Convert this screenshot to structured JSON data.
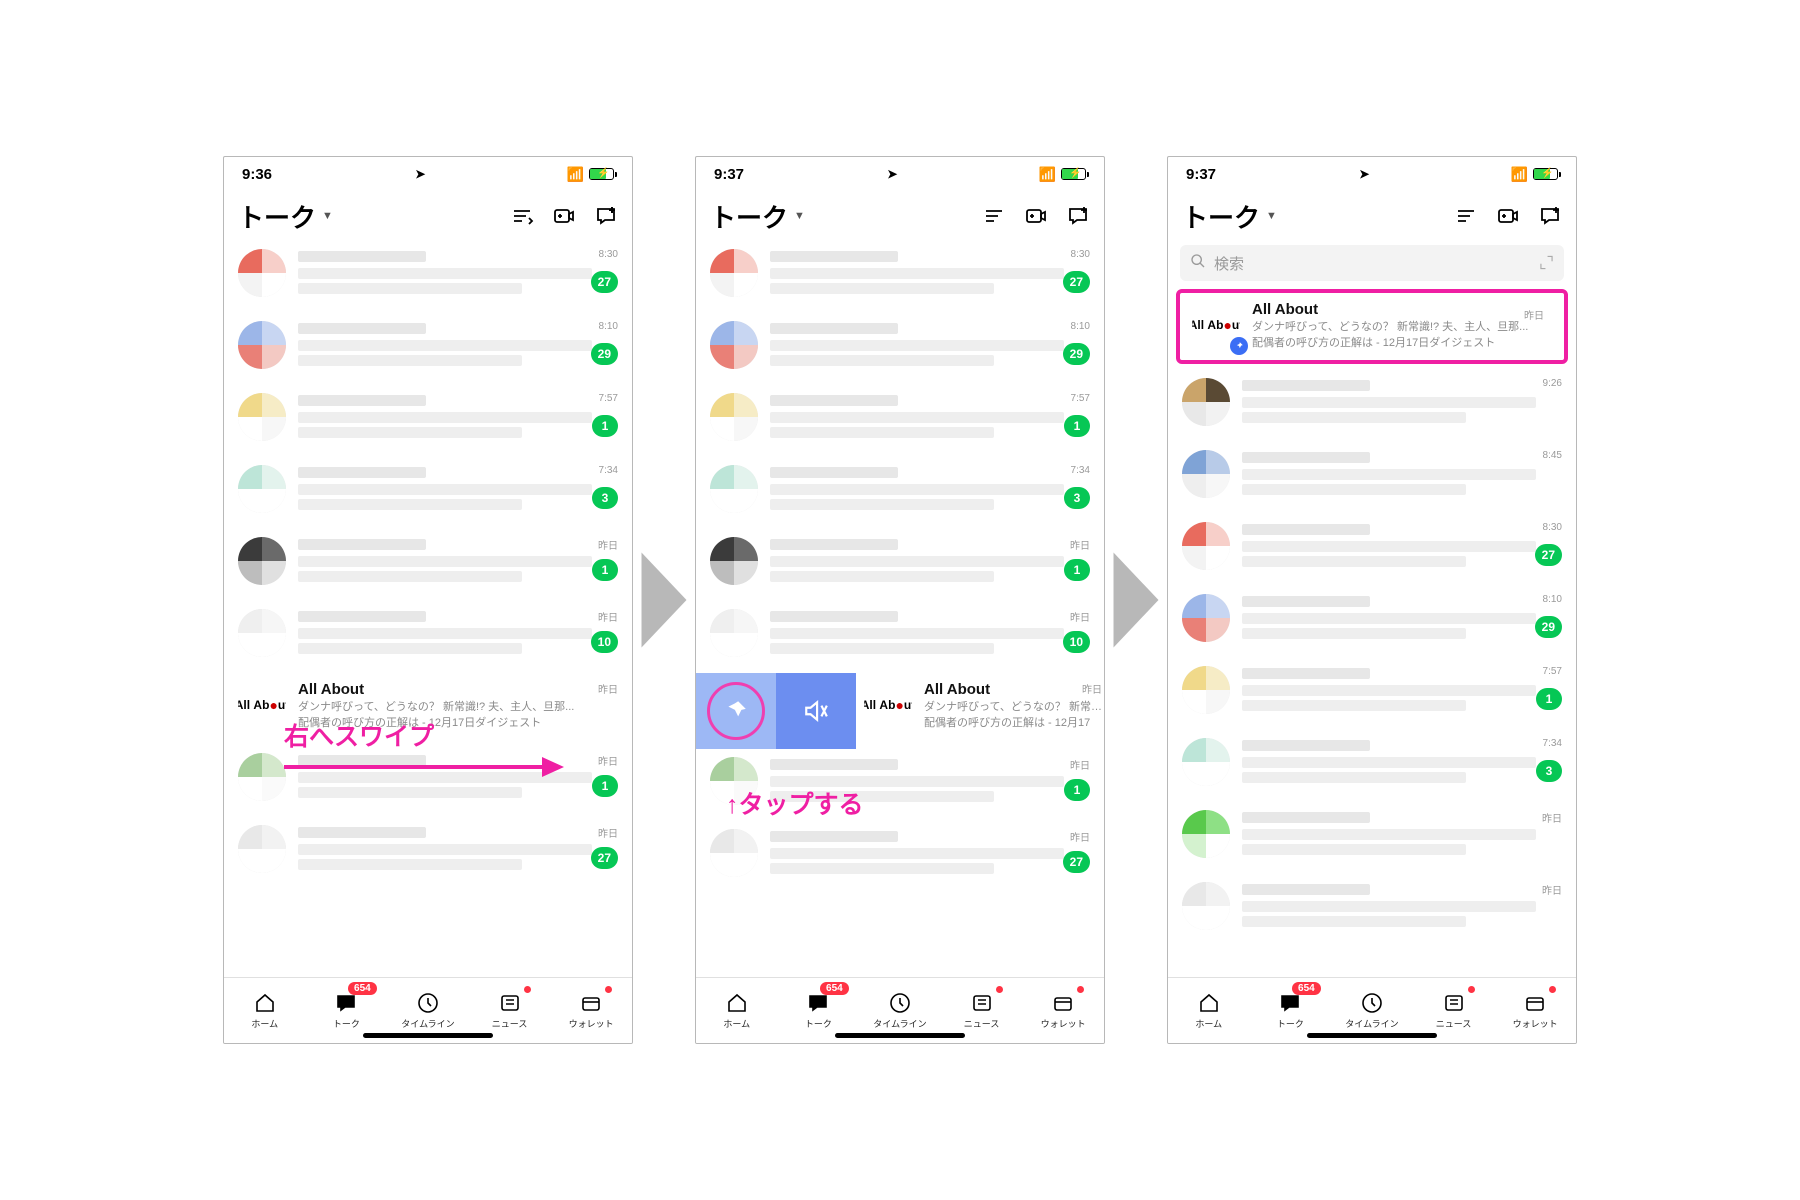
{
  "status": {
    "t1": "9:36",
    "t2": "9:37",
    "t3": "9:37"
  },
  "header": {
    "title": "トーク"
  },
  "search": {
    "placeholder": "検索"
  },
  "ann": {
    "swipe": "右へスワイプ",
    "tap": "↑タップする"
  },
  "allabout": {
    "name": "All About",
    "line1": "ダンナ呼びって、どうなの？ 新常識!? 夫、主人、旦那...",
    "line2": "配偶者の呼び方の正解は - 12月17日ダイジェスト",
    "line1s": "ダンナ呼びって、どうなの？ 新常…",
    "line2s": "配偶者の呼び方の正解は - 12月17",
    "when": "昨日"
  },
  "chats1": [
    {
      "time": "8:30",
      "badge": "27",
      "av": [
        "#e86b5e",
        "#f7cfc9",
        "#f3f3f3",
        "#fff"
      ]
    },
    {
      "time": "8:10",
      "badge": "29",
      "av": [
        "#9cb6e8",
        "#c8d6f2",
        "#e98077",
        "#f3c9c3"
      ]
    },
    {
      "time": "7:57",
      "badge": "1",
      "av": [
        "#f0d98a",
        "#f6ecc6",
        "#fff",
        "#f7f7f7"
      ]
    },
    {
      "time": "7:34",
      "badge": "3",
      "av": [
        "#bde5d8",
        "#e3f3ed",
        "#fff",
        "#fff"
      ]
    },
    {
      "time": "昨日",
      "badge": "1",
      "av": [
        "#3b3b3b",
        "#6a6a6a",
        "#bdbdbd",
        "#e0e0e0"
      ]
    },
    {
      "time": "昨日",
      "badge": "10",
      "av": [
        "#efefef",
        "#f6f6f6",
        "#fff",
        "#fff"
      ]
    },
    {
      "time": "昨日",
      "badge": "",
      "av": [
        "allabout"
      ]
    },
    {
      "time": "昨日",
      "badge": "1",
      "av": [
        "#a9cf9e",
        "#d4e8cc",
        "#fff",
        "#fafafa"
      ]
    },
    {
      "time": "昨日",
      "badge": "27",
      "av": [
        "#e8e8e8",
        "#f2f2f2",
        "#fff",
        "#fff"
      ]
    }
  ],
  "chats3": [
    {
      "time": "9:26",
      "badge": "",
      "av": [
        "#caa46a",
        "#5a4a34",
        "#e8e8e8",
        "#f2f2f2"
      ]
    },
    {
      "time": "8:45",
      "badge": "",
      "av": [
        "#7fa3d6",
        "#b8cbe8",
        "#eee",
        "#f7f7f7"
      ]
    },
    {
      "time": "8:30",
      "badge": "27",
      "av": [
        "#e86b5e",
        "#f7cfc9",
        "#f3f3f3",
        "#fff"
      ]
    },
    {
      "time": "8:10",
      "badge": "29",
      "av": [
        "#9cb6e8",
        "#c8d6f2",
        "#e98077",
        "#f3c9c3"
      ]
    },
    {
      "time": "7:57",
      "badge": "1",
      "av": [
        "#f0d98a",
        "#f6ecc6",
        "#fff",
        "#f7f7f7"
      ]
    },
    {
      "time": "7:34",
      "badge": "3",
      "av": [
        "#bde5d8",
        "#e3f3ed",
        "#fff",
        "#fff"
      ]
    },
    {
      "time": "昨日",
      "badge": "",
      "av": [
        "#59c94c",
        "#8ee085",
        "#d4f2cf",
        "#fff"
      ]
    },
    {
      "time": "昨日",
      "badge": "",
      "av": [
        "#e8e8e8",
        "#f2f2f2",
        "#fff",
        "#fff"
      ]
    }
  ],
  "tabs": {
    "home": "ホーム",
    "talk": "トーク",
    "timeline": "タイムライン",
    "news": "ニュース",
    "wallet": "ウォレット",
    "talkBadge": "654"
  }
}
